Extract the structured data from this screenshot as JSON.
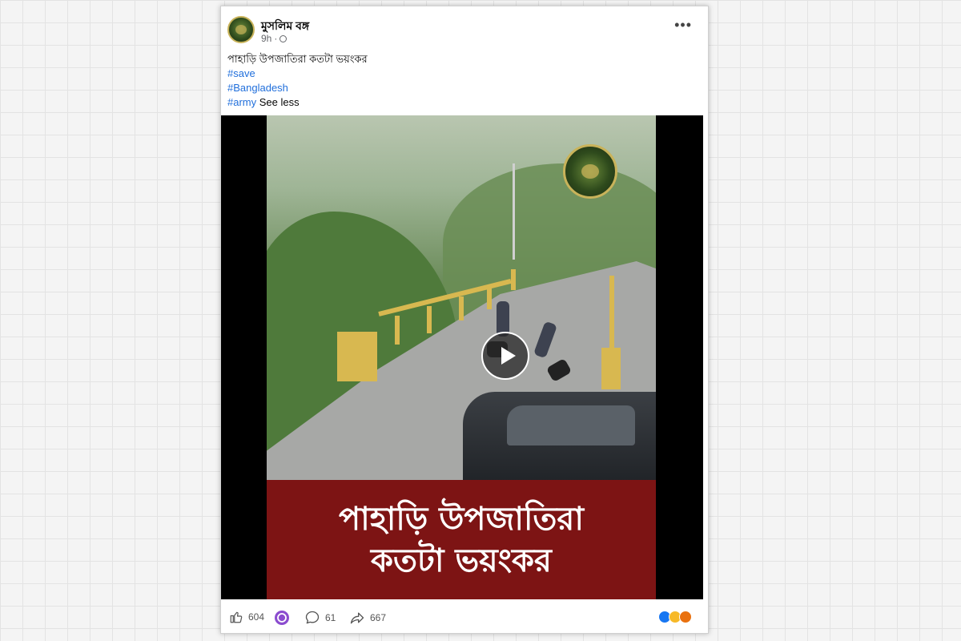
{
  "post": {
    "page_name": "মুসলিম বঙ্গ",
    "time": "9h",
    "separator": "·",
    "text": "পাহাড়ি উপজাতিরা কতটা ভয়ংকর",
    "hashtags": [
      "#save",
      "#Bangladesh",
      "#army"
    ],
    "see_less": "See less",
    "more_glyph": "•••"
  },
  "video": {
    "overlay_line1": "পাহাড়ি উপজাতিরা",
    "overlay_line2": "কতটা ভয়ংকর"
  },
  "footer": {
    "likes": "604",
    "comments": "61",
    "shares": "667"
  },
  "icons": {
    "like": "thumbs-up-icon",
    "comment": "comment-bubble-icon",
    "share": "share-arrow-icon",
    "purple_badge": "purple-badge-icon",
    "reactions": [
      "like-reaction-icon",
      "wow-reaction-icon",
      "angry-reaction-icon"
    ]
  },
  "colors": {
    "hashtag": "#216fdb",
    "banner": "#7d1414",
    "like_blue": "#1877f2"
  }
}
